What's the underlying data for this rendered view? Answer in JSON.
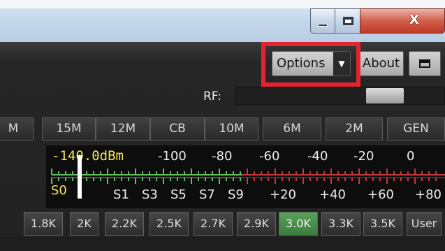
{
  "window": {
    "minimize_icon": "minimize-icon",
    "maximize_icon": "maximize-icon",
    "close_glyph": "X"
  },
  "toolbar": {
    "options_label": "Options",
    "options_arrow": "▼",
    "about_label": "About",
    "highlight_color": "#e5232f"
  },
  "rf": {
    "label": "RF:",
    "level": 0.77
  },
  "bands": [
    "M",
    "15M",
    "12M",
    "CB",
    "10M",
    "6M",
    "2M",
    "GEN"
  ],
  "meter": {
    "reading": "-140.0dBm",
    "top_scale": [
      "-100",
      "-80",
      "-60",
      "-40",
      "-20",
      "0"
    ],
    "s_label": "S0",
    "bottom_scale": [
      "S1",
      "S3",
      "S5",
      "S7",
      "S9",
      "+20",
      "+40",
      "+60",
      "+80"
    ],
    "green": "#5fbf5f",
    "red": "#c23a3a",
    "yellow": "#f2e45e"
  },
  "filters": {
    "items": [
      "1.8K",
      "2K",
      "2.2K",
      "2.5K",
      "2.7K",
      "2.9K",
      "3.0K",
      "3.3K",
      "3.5K",
      "User"
    ],
    "selected": "3.0K",
    "selected_color": "#4a944c"
  }
}
